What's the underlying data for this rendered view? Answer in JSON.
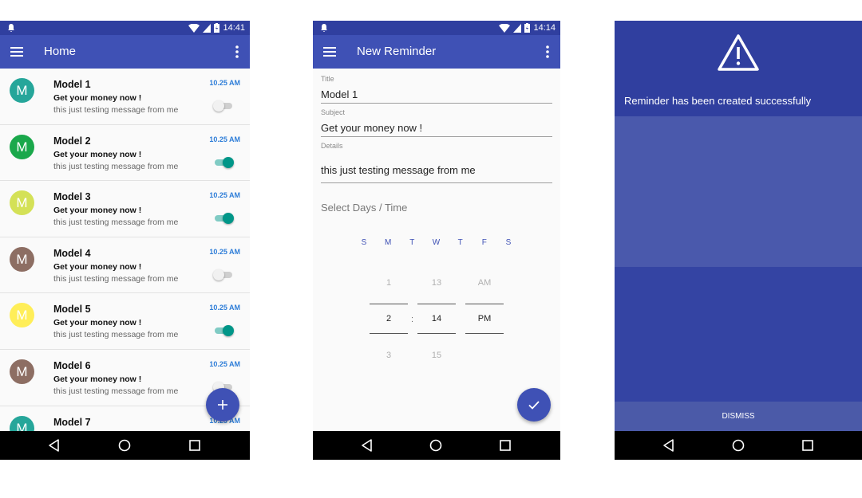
{
  "colors": {
    "primary": "#3f51b5",
    "primary_dark": "#303f9f",
    "accent_teal": "#009688",
    "time_blue": "#2f7ed8"
  },
  "status_bar": {
    "icons": [
      "bell-icon",
      "wifi-icon",
      "signal-icon",
      "battery-icon"
    ]
  },
  "screen_home": {
    "status_time": "14:41",
    "title": "Home",
    "items": [
      {
        "avatar": "M",
        "avatar_color": "#26a69a",
        "name": "Model 1",
        "subject": "Get your money now !",
        "details": "this just testing message from me",
        "time": "10.25 AM",
        "enabled": false
      },
      {
        "avatar": "M",
        "avatar_color": "#1aa84b",
        "name": "Model 2",
        "subject": "Get your money now !",
        "details": "this just testing message from me",
        "time": "10.25 AM",
        "enabled": true
      },
      {
        "avatar": "M",
        "avatar_color": "#d4e157",
        "name": "Model 3",
        "subject": "Get your money now !",
        "details": "this just testing message from me",
        "time": "10.25 AM",
        "enabled": true
      },
      {
        "avatar": "M",
        "avatar_color": "#8d6e63",
        "name": "Model 4",
        "subject": "Get your money now !",
        "details": "this just testing message from me",
        "time": "10.25 AM",
        "enabled": false
      },
      {
        "avatar": "M",
        "avatar_color": "#ffee58",
        "name": "Model 5",
        "subject": "Get your money now !",
        "details": "this just testing message from me",
        "time": "10.25 AM",
        "enabled": true
      },
      {
        "avatar": "M",
        "avatar_color": "#8d6e63",
        "name": "Model 6",
        "subject": "Get your money now !",
        "details": "this just testing message from me",
        "time": "10.25 AM",
        "enabled": false
      },
      {
        "avatar": "M",
        "avatar_color": "#26a69a",
        "name": "Model 7",
        "subject": "",
        "details": "",
        "time": "10.25 AM",
        "enabled": false
      }
    ],
    "fab_icon": "plus-icon"
  },
  "screen_new_reminder": {
    "status_time": "14:14",
    "title": "New Reminder",
    "fields": {
      "title_label": "Title",
      "title_value": "Model 1",
      "subject_label": "Subject",
      "subject_value": "Get your money now !",
      "details_label": "Details",
      "details_value": "this just testing message from me"
    },
    "section_title": "Select Days / Time",
    "days": [
      "S",
      "M",
      "T",
      "W",
      "T",
      "F",
      "S"
    ],
    "picker": {
      "hour_prev": "1",
      "hour": "2",
      "hour_next": "3",
      "separator": ":",
      "minute_prev": "13",
      "minute": "14",
      "minute_next": "15",
      "ampm_prev": "AM",
      "ampm": "PM"
    },
    "fab_icon": "check-icon"
  },
  "screen_dialog": {
    "icon": "warning-icon",
    "message": "Reminder has been created successfully",
    "dismiss_label": "DISMISS"
  },
  "nav_bar": {
    "icons": [
      "back-icon",
      "home-icon",
      "recents-icon"
    ]
  }
}
